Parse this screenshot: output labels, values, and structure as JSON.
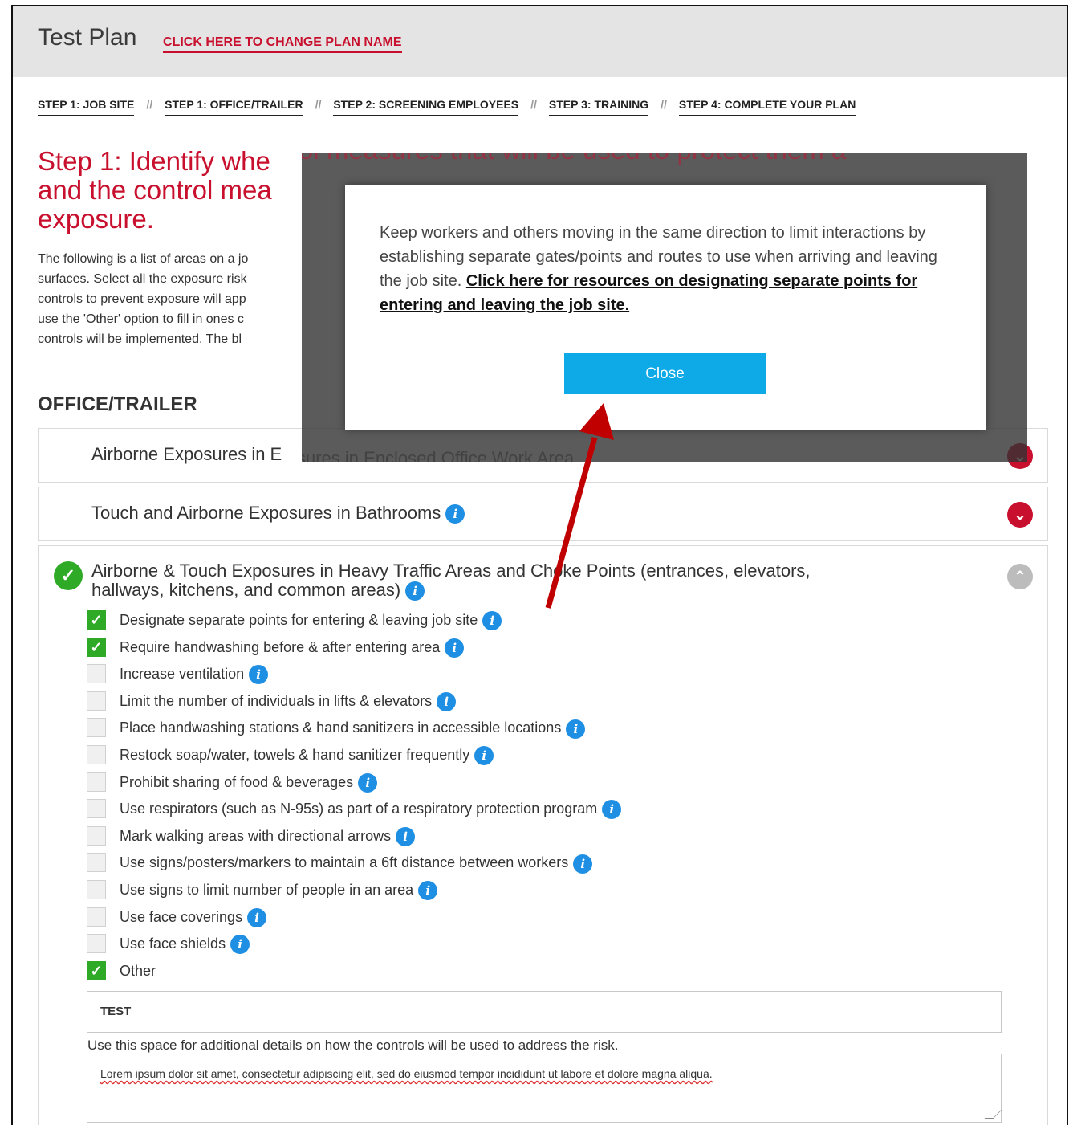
{
  "header": {
    "plan_name": "Test Plan",
    "change_link": "CLICK HERE TO CHANGE PLAN NAME"
  },
  "steps": [
    "STEP 1: JOB SITE",
    "STEP 1: OFFICE/TRAILER",
    "STEP 2: SCREENING EMPLOYEES",
    "STEP 3: TRAINING",
    "STEP 4: COMPLETE YOUR PLAN"
  ],
  "step_separator": "//",
  "heading": {
    "line1": "Step 1: Identify whe",
    "line2": "and the control mea",
    "line3": "exposure.",
    "ghost_text": "ol measures that will be used to protect them a"
  },
  "intro": {
    "l1": "The following is a list of areas on a jo",
    "l2": "surfaces. Select all the exposure risk",
    "l3": "controls to prevent exposure will app",
    "l4": "use the 'Other' option to fill in ones c",
    "l5": "controls will be implemented. The bl"
  },
  "section_title": "OFFICE/TRAILER",
  "panels": {
    "p1_title": "Airborne Exposures in E",
    "p1_ghost": "sures in Enclosed Office Work Area",
    "p2_title": "Touch and Airborne Exposures in Bathrooms",
    "p3_title_l1": "Airborne & Touch Exposures in Heavy Traffic Areas and Choke Points (entrances, elevators,",
    "p3_title_l2": "hallways, kitchens, and common areas)"
  },
  "options": [
    {
      "label": "Designate separate points for entering & leaving job site",
      "checked": true
    },
    {
      "label": "Require handwashing before & after entering area",
      "checked": true
    },
    {
      "label": "Increase ventilation",
      "checked": false
    },
    {
      "label": "Limit the number of individuals in lifts & elevators",
      "checked": false
    },
    {
      "label": "Place handwashing stations & hand sanitizers in accessible locations",
      "checked": false
    },
    {
      "label": "Restock soap/water, towels & hand sanitizer frequently",
      "checked": false
    },
    {
      "label": "Prohibit sharing of food & beverages",
      "checked": false
    },
    {
      "label": "Use respirators (such as N-95s) as part of a respiratory protection program",
      "checked": false
    },
    {
      "label": "Mark walking areas with directional arrows",
      "checked": false
    },
    {
      "label": "Use signs/posters/markers to maintain a 6ft distance between workers",
      "checked": false
    },
    {
      "label": "Use signs to limit number of people in an area",
      "checked": false
    },
    {
      "label": "Use face coverings",
      "checked": false
    },
    {
      "label": "Use face shields",
      "checked": false
    },
    {
      "label": "Other",
      "checked": true
    }
  ],
  "other_value": "TEST",
  "details_label": "Use this space for additional details on how the controls will be used to address the risk.",
  "details_value": "Lorem ipsum dolor sit amet, consectetur adipiscing elit, sed do eiusmod tempor incididunt ut labore et dolore magna aliqua.",
  "modal": {
    "text": "Keep workers and others moving in the same direction to limit interactions by establishing separate gates/points and routes to use when arriving and leaving the job site. ",
    "link": "Click here for resources on designating separate points for entering and leaving the job site. ",
    "close_label": "Close"
  },
  "icons": {
    "info": "info-icon",
    "check": "checkmark-icon",
    "chevron_down": "chevron-down-icon",
    "chevron_up": "chevron-up-icon"
  },
  "colors": {
    "brand_red": "#c8102e",
    "info_blue": "#1e8fe3",
    "close_blue": "#0eaae8",
    "check_green": "#2eaa27",
    "annotation_arrow": "#c00000"
  }
}
